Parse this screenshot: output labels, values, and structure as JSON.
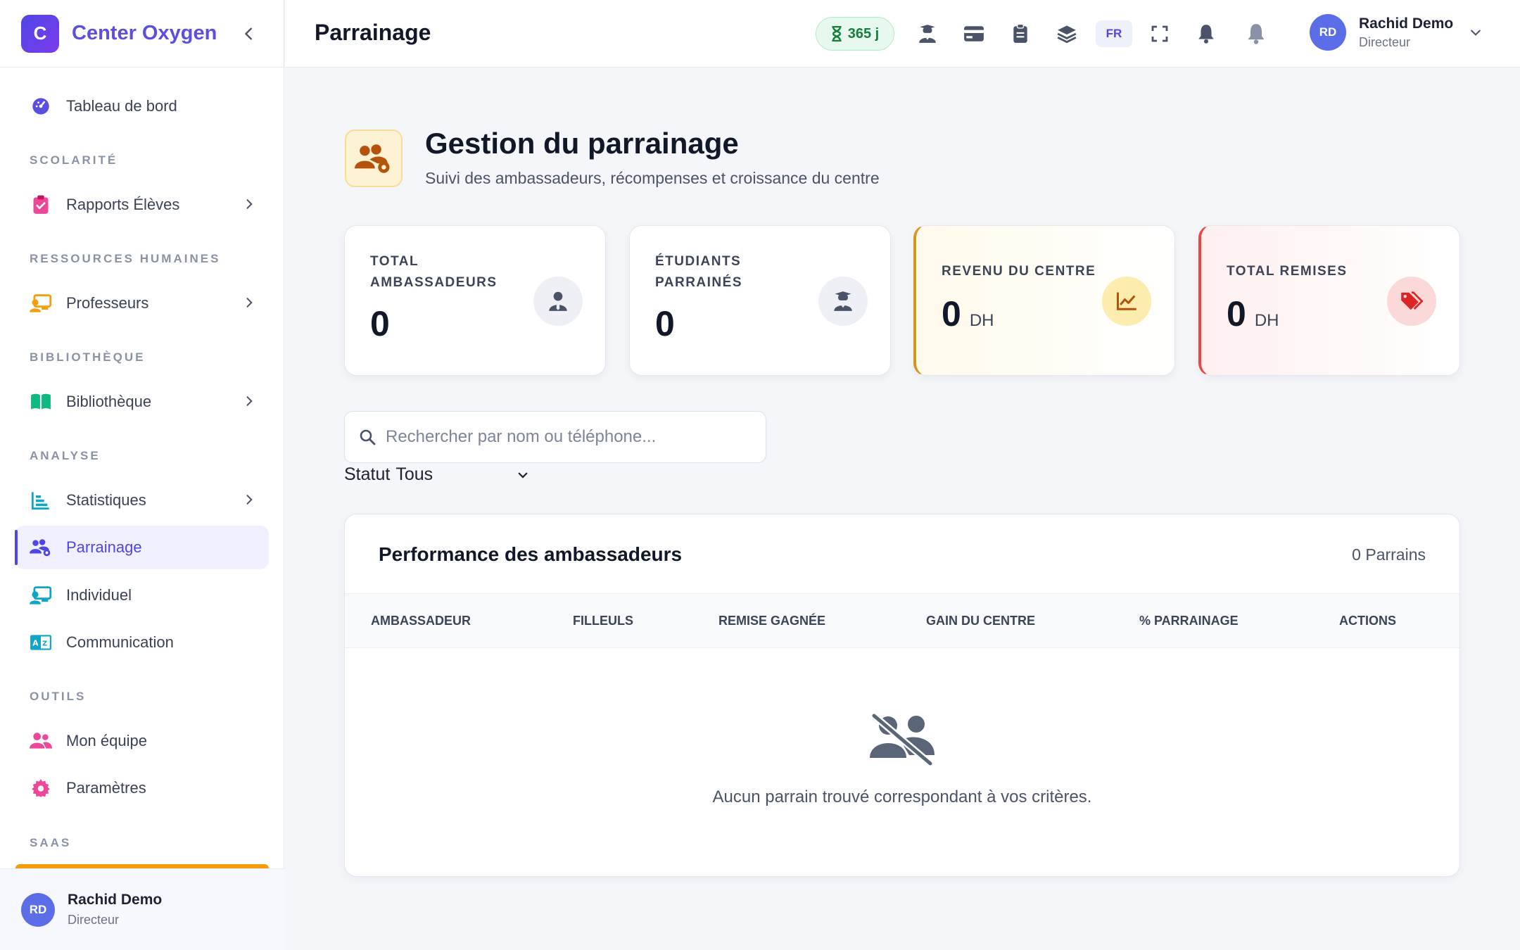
{
  "brand": {
    "logo_letter": "C",
    "name": "Center Oxygen"
  },
  "sidebar": {
    "dashboard": "Tableau de bord",
    "sections": {
      "scolarite": "SCOLARITÉ",
      "rh": "RESSOURCES HUMAINES",
      "bibliotheque": "BIBLIOTHÈQUE",
      "analyse": "ANALYSE",
      "outils": "OUTILS",
      "saas": "SAAS"
    },
    "items": {
      "rapports": "Rapports Élèves",
      "professeurs": "Professeurs",
      "bibliotheque": "Bibliothèque",
      "statistiques": "Statistiques",
      "parrainage": "Parrainage",
      "individuel": "Individuel",
      "communication": "Communication",
      "equipe": "Mon équipe",
      "parametres": "Paramètres"
    },
    "footer": {
      "initials": "RD",
      "name": "Rachid Demo",
      "role": "Directeur"
    }
  },
  "topbar": {
    "title": "Parrainage",
    "trial_days": "365 j",
    "lang": "FR",
    "user": {
      "initials": "RD",
      "name": "Rachid Demo",
      "role": "Directeur"
    }
  },
  "header": {
    "title": "Gestion du parrainage",
    "subtitle": "Suivi des ambassadeurs, récompenses et croissance du centre"
  },
  "stats": [
    {
      "label_line1": "TOTAL",
      "label_line2": "AMBASSADEURS",
      "value": "0",
      "unit": ""
    },
    {
      "label_line1": "ÉTUDIANTS",
      "label_line2": "PARRAINÉS",
      "value": "0",
      "unit": ""
    },
    {
      "label": "REVENU DU CENTRE",
      "value": "0",
      "unit": "DH"
    },
    {
      "label": "TOTAL REMISES",
      "value": "0",
      "unit": "DH"
    }
  ],
  "search": {
    "placeholder": "Rechercher par nom ou téléphone..."
  },
  "filter": {
    "label": "Statut",
    "value": "Tous"
  },
  "table": {
    "title": "Performance des ambassadeurs",
    "count": "0 Parrains",
    "columns": [
      "AMBASSADEUR",
      "FILLEULS",
      "REMISE GAGNÉE",
      "GAIN DU CENTRE",
      "% PARRAINAGE",
      "ACTIONS"
    ],
    "empty": "Aucun parrain trouvé correspondant à vos critères."
  },
  "colors": {
    "accent": "#4f46e5",
    "gold": "#d49520",
    "red": "#e64747",
    "green": "#15803d"
  }
}
